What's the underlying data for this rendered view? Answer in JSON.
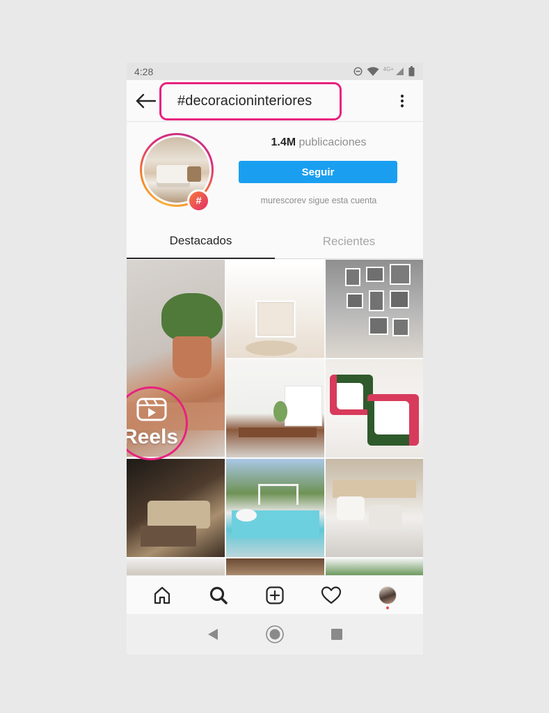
{
  "status_bar": {
    "time": "4:28",
    "network": "4G+",
    "icons": [
      "do-not-disturb-icon",
      "wifi-icon",
      "signal-icon",
      "battery-icon"
    ]
  },
  "header": {
    "title": "#decoracioninteriores",
    "back_icon": "back-arrow-icon",
    "more_icon": "more-vertical-icon"
  },
  "hashtag": {
    "post_count": "1.4M",
    "post_count_label": "publicaciones",
    "badge": "#",
    "follow_label": "Seguir",
    "follow_note": "murescorev sigue esta cuenta"
  },
  "tabs": [
    {
      "label": "Destacados",
      "active": true
    },
    {
      "label": "Recientes",
      "active": false
    }
  ],
  "grid": {
    "reels_label": "Reels"
  },
  "bottom_nav": [
    "home-icon",
    "search-icon",
    "add-post-icon",
    "heart-icon",
    "profile-avatar"
  ],
  "colors": {
    "accent": "#1a9ff0",
    "highlight": "#e8217f",
    "notification": "#ed4956"
  }
}
